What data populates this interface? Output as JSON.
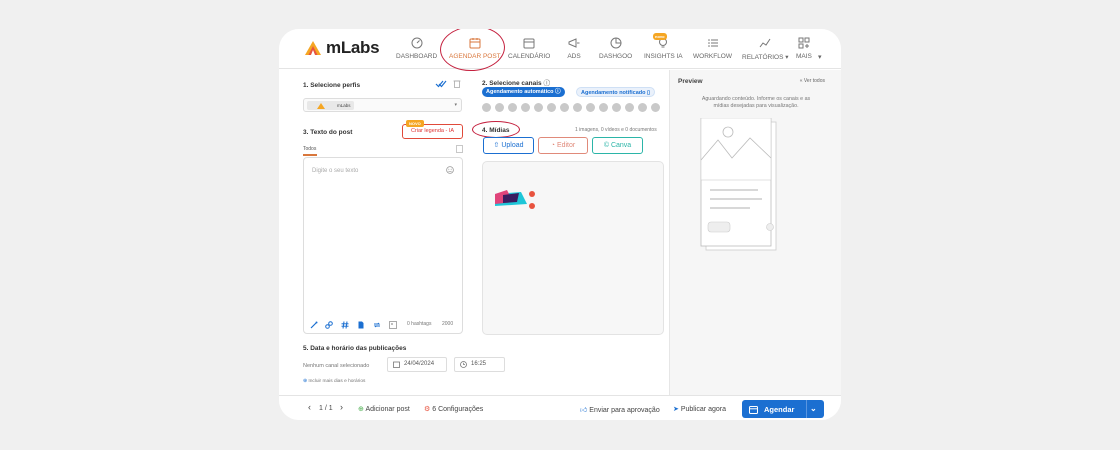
{
  "app": {
    "logo_text": "mLabs",
    "brand_color": "#f5a623",
    "accent_color": "#1b6fd1",
    "highlight_color": "#c4203e"
  },
  "nav": {
    "items": [
      {
        "label": "DASHBOARD",
        "icon": "speedometer-icon"
      },
      {
        "label": "AGENDAR POST",
        "icon": "calendar-post-icon",
        "active": true
      },
      {
        "label": "CALENDÁRIO",
        "icon": "calendar-icon"
      },
      {
        "label": "ADS",
        "icon": "megaphone-icon"
      },
      {
        "label": "DASHGOO",
        "icon": "pie-chart-icon"
      },
      {
        "label": "INSIGHTS IA",
        "icon": "lightbulb-icon",
        "badge": "novo"
      },
      {
        "label": "WORKFLOW",
        "icon": "checklist-icon"
      },
      {
        "label": "RELATÓRIOS ▾",
        "icon": "line-chart-icon"
      },
      {
        "label": "MAIS",
        "icon": "grid-plus-icon"
      }
    ],
    "more_arrow": "▾"
  },
  "left": {
    "profile_title": "1. Selecione perfis",
    "profile_chip": "mLabs",
    "text_title": "3. Texto do post",
    "legend_button": "Criar legenda - IA",
    "legend_badge": "NOVO",
    "tab_all": "Todos",
    "editor_placeholder": "Digite o seu texto",
    "hashtag_count": "0 hashtags",
    "char_count": "2000",
    "date_title": "5. Data e horário das publicações",
    "no_channel": "Nenhum canal selecionado",
    "date_value": "24/04/2024",
    "time_value": "16:25",
    "add_dates": "Incluir mais dias e horários"
  },
  "middle": {
    "channels_title": "2. Selecione canais",
    "auto_schedule": "Agendamento automático",
    "notify_schedule": "Agendamento notificado",
    "media_title": "4. Mídias",
    "media_counts": "1 imagens, 0 vídeos e 0 documentos",
    "upload_label": "Upload",
    "editor_label": "Editor",
    "canva_label": "Canva"
  },
  "preview": {
    "title": "Preview",
    "view_all": "« Ver todos",
    "message": "Aguardando conteúdo. Informe os canais e as mídias desejadas para visualização."
  },
  "bottom": {
    "pagination": "1 / 1",
    "add_post": "Adicionar post",
    "settings_count": "6",
    "settings_label": "Configurações",
    "send_approval": "Enviar para aprovação",
    "publish_now": "Publicar agora",
    "schedule_label": "Agendar"
  }
}
